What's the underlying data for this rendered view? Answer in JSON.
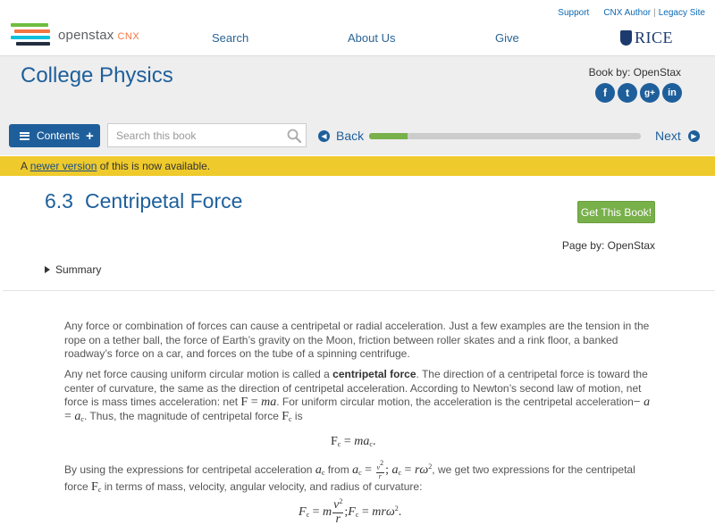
{
  "header": {
    "logo": {
      "brand": "openstax",
      "suffix": "CNX"
    },
    "utility_links": [
      "Support",
      "CNX Author",
      "Legacy Site"
    ],
    "nav": [
      "Search",
      "About Us",
      "Give"
    ],
    "partner_logo": "RICE"
  },
  "book": {
    "title": "College Physics",
    "book_by": "Book by: OpenStax",
    "socials": [
      {
        "label": "f",
        "icon": "facebook-icon"
      },
      {
        "label": "t",
        "icon": "twitter-icon"
      },
      {
        "label": "g+",
        "icon": "google-plus-icon"
      },
      {
        "label": "in",
        "icon": "linkedin-icon"
      }
    ]
  },
  "toolbar": {
    "contents_label": "Contents",
    "search_placeholder": "Search this book",
    "back_label": "Back",
    "next_label": "Next",
    "progress_fraction": 0.14
  },
  "notice": {
    "prefix": "A ",
    "link": "newer version",
    "suffix": " of this is now available."
  },
  "page": {
    "section_number": "6.3",
    "section_title": "Centripetal Force",
    "get_book_label": "Get This Book!",
    "page_by": "Page by: OpenStax",
    "summary_label": "Summary"
  },
  "content": {
    "p1": "Any force or combination of forces can cause a centripetal or radial acceleration. Just a few examples are the tension in the rope on a tether ball, the force of Earth’s gravity on the Moon, friction between roller skates and a rink floor, a banked roadway’s force on a car, and forces on the tube of a spinning centrifuge.",
    "p2_a": "Any net force causing uniform circular motion is called a ",
    "p2_bold": "centripetal force",
    "p2_b": ". The direction of a centripetal force is toward the center of curvature, the same as the direction of centripetal acceleration. According to Newton’s second law of motion, net force is mass times acceleration: net ",
    "p2_c": ". For uniform circular motion, the acceleration is the centripetal acceleration",
    "p2_d": ". Thus, the magnitude of centripetal force ",
    "p2_e": " is",
    "p3_a": "By using the expressions for centripetal acceleration ",
    "p3_b": " from ",
    "p3_c": ", we get two expressions for the centripetal force ",
    "p3_d": " in terms of mass, velocity, angular velocity, and radius of curvature:"
  },
  "colors": {
    "brand_blue": "#1e5f9b",
    "notice_yellow": "#efca2c",
    "progress_green": "#78b04a"
  }
}
